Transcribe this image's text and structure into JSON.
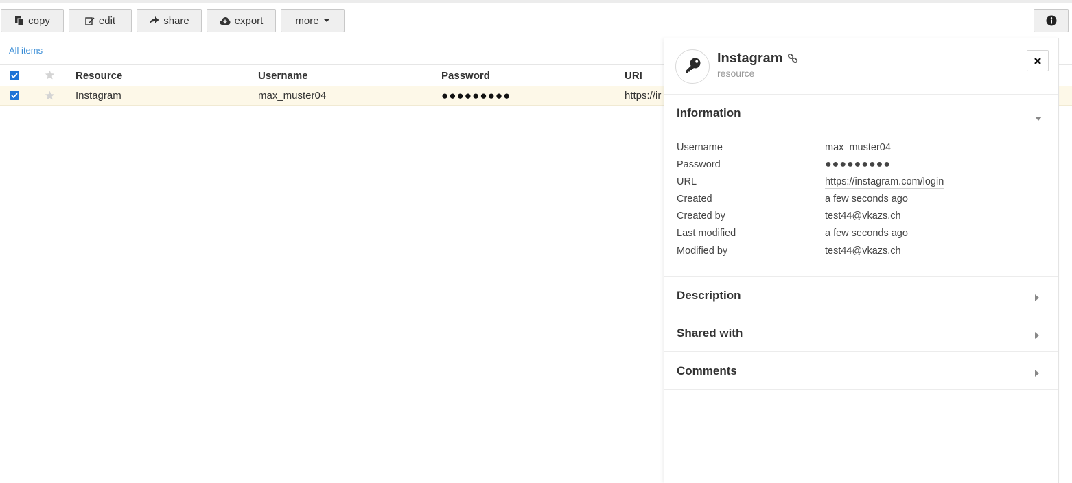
{
  "toolbar": {
    "copy": "copy",
    "edit": "edit",
    "share": "share",
    "export": "export",
    "more": "more"
  },
  "breadcrumb": "All items",
  "table": {
    "headers": {
      "resource": "Resource",
      "username": "Username",
      "password": "Password",
      "uri": "URI"
    },
    "rows": [
      {
        "resource": "Instagram",
        "username": "max_muster04",
        "password": "●●●●●●●●●",
        "uri": "https://ir"
      }
    ]
  },
  "panel": {
    "title": "Instagram",
    "subtitle": "resource",
    "information": {
      "title": "Information",
      "rows": [
        {
          "label": "Username",
          "value": "max_muster04"
        },
        {
          "label": "Password",
          "value": "●●●●●●●●●"
        },
        {
          "label": "URL",
          "value": "https://instagram.com/login"
        },
        {
          "label": "Created",
          "value": "a few seconds ago"
        },
        {
          "label": "Created by",
          "value": "test44@vkazs.ch"
        },
        {
          "label": "Last modified",
          "value": "a few seconds ago"
        },
        {
          "label": "Modified by",
          "value": "test44@vkazs.ch"
        }
      ]
    },
    "sections": [
      {
        "title": "Description"
      },
      {
        "title": "Shared with"
      },
      {
        "title": "Comments"
      }
    ]
  },
  "colors": {
    "accent": "#1e74d6",
    "link": "#3a8dd6",
    "selected_row": "#fdf8e8"
  }
}
